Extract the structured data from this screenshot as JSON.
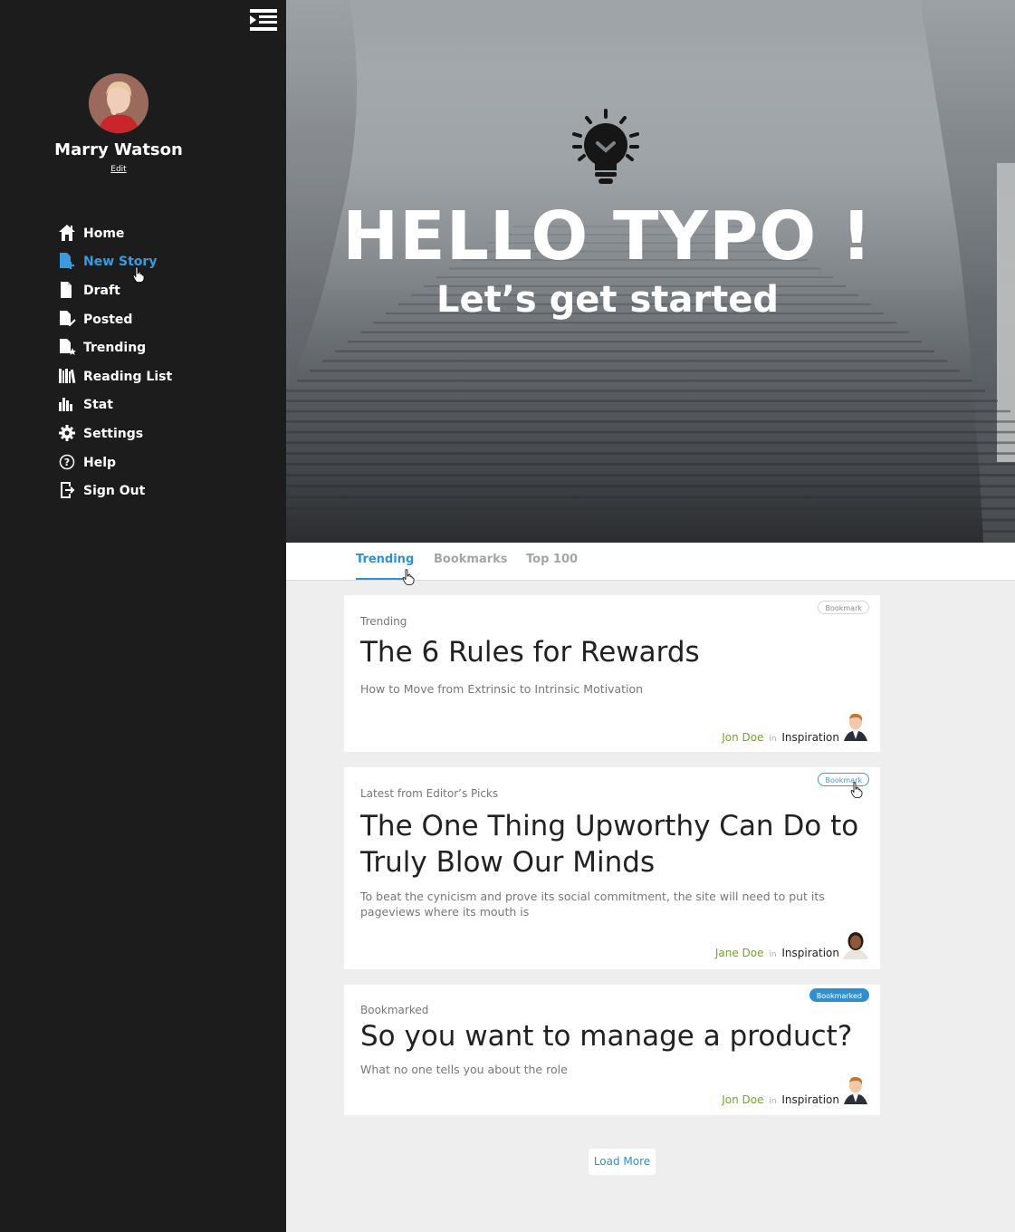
{
  "sidebar": {
    "user_name": "Marry Watson",
    "edit_label": "Edit",
    "items": [
      {
        "label": "Home",
        "icon": "home-icon"
      },
      {
        "label": "New Story",
        "icon": "new-story-icon",
        "active": true
      },
      {
        "label": "Draft",
        "icon": "draft-icon"
      },
      {
        "label": "Posted",
        "icon": "posted-icon"
      },
      {
        "label": "Trending",
        "icon": "trending-icon"
      },
      {
        "label": "Reading List",
        "icon": "reading-list-icon"
      },
      {
        "label": "Stat",
        "icon": "stat-icon"
      },
      {
        "label": "Settings",
        "icon": "gear-icon"
      },
      {
        "label": "Help",
        "icon": "help-icon"
      },
      {
        "label": "Sign Out",
        "icon": "sign-out-icon"
      }
    ]
  },
  "hero": {
    "title": "HELLO TYPO !",
    "subtitle": "Let’s get started"
  },
  "tabs": [
    {
      "label": "Trending",
      "active": true
    },
    {
      "label": "Bookmarks"
    },
    {
      "label": "Top 100"
    }
  ],
  "cards": [
    {
      "category": "Trending",
      "title": "The 6 Rules for Rewards",
      "description": "How to Move from Extrinsic to Intrinsic Motivation",
      "badge": "Bookmark",
      "author": "Jon Doe",
      "in": "in",
      "topic": "Inspiration"
    },
    {
      "category": "Latest from Editor’s Picks",
      "title": "The One Thing Upworthy Can Do to Truly Blow Our Minds",
      "description": "To beat the cynicism and prove its social commitment, the site will need to put its pageviews where its mouth is",
      "badge": "Bookmark",
      "author": "Jane Doe",
      "in": "in",
      "topic": "Inspiration"
    },
    {
      "category": "Bookmarked",
      "title": "So you want to manage a product?",
      "description": "What no one tells you about the role",
      "badge": "Bookmarked",
      "author": "Jon Doe",
      "in": "in",
      "topic": "Inspiration"
    }
  ],
  "load_more_label": "Load More",
  "colors": {
    "sidebar_bg": "#1c1c1d",
    "accent": "#2f90d1",
    "author_green": "#71a723"
  }
}
